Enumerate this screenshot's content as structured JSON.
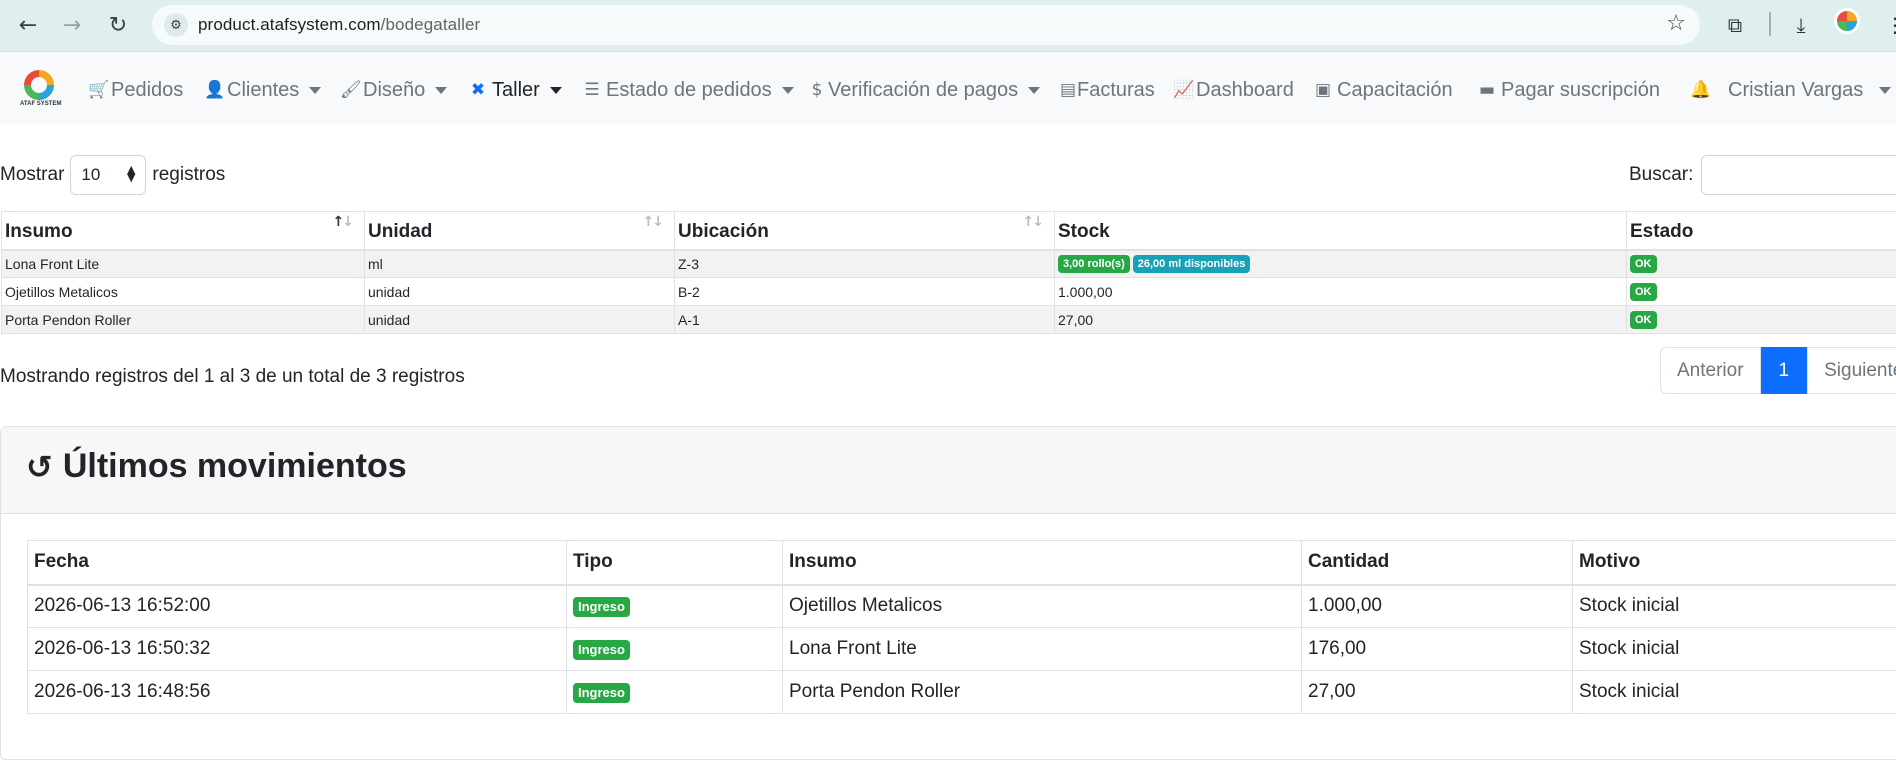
{
  "browser": {
    "url_host": "product.atafsystem.com",
    "url_path": "/bodegataller"
  },
  "navbar": {
    "logo_text": "ATAF SYSTEM",
    "items": [
      {
        "label": "Pedidos",
        "icon": "cart-icon",
        "dropdown": false
      },
      {
        "label": "Clientes",
        "icon": "users-icon",
        "dropdown": true
      },
      {
        "label": "Diseño",
        "icon": "brush-icon",
        "dropdown": true
      },
      {
        "label": "Taller",
        "icon": "tools-icon",
        "dropdown": true,
        "active": true
      },
      {
        "label": "Estado de pedidos",
        "icon": "list-check-icon",
        "dropdown": true
      },
      {
        "label": "Verificación de pagos",
        "icon": "dollar-icon",
        "dropdown": true
      },
      {
        "label": "Facturas",
        "icon": "invoice-icon",
        "dropdown": false
      },
      {
        "label": "Dashboard",
        "icon": "chart-line-icon",
        "dropdown": false
      },
      {
        "label": "Capacitación",
        "icon": "chalkboard-icon",
        "dropdown": false
      },
      {
        "label": "Pagar suscripción",
        "icon": "credit-card-icon",
        "dropdown": false
      }
    ],
    "user_name": "Cristian Vargas"
  },
  "datatable": {
    "length_prefix": "Mostrar",
    "length_value": "10",
    "length_suffix": "registros",
    "search_label": "Buscar:",
    "columns": [
      "Insumo",
      "Unidad",
      "Ubicación",
      "Stock",
      "Estado"
    ],
    "rows": [
      {
        "insumo": "Lona Front Lite",
        "unidad": "ml",
        "ubicacion": "Z-3",
        "stock_badges": [
          "3,00 rollo(s)",
          "26,00 ml disponibles"
        ],
        "estado": "OK"
      },
      {
        "insumo": "Ojetillos Metalicos",
        "unidad": "unidad",
        "ubicacion": "B-2",
        "stock": "1.000,00",
        "estado": "OK"
      },
      {
        "insumo": "Porta Pendon Roller",
        "unidad": "unidad",
        "ubicacion": "A-1",
        "stock": "27,00",
        "estado": "OK"
      }
    ],
    "info": "Mostrando registros del 1 al 3 de un total de 3 registros",
    "pager": {
      "prev": "Anterior",
      "current": "1",
      "next": "Siguiente"
    }
  },
  "movimientos": {
    "title": "Últimos movimientos",
    "columns": [
      "Fecha",
      "Tipo",
      "Insumo",
      "Cantidad",
      "Motivo"
    ],
    "rows": [
      {
        "fecha": "2026-06-13 16:52:00",
        "tipo": "Ingreso",
        "insumo": "Ojetillos Metalicos",
        "cantidad": "1.000,00",
        "motivo": "Stock inicial"
      },
      {
        "fecha": "2026-06-13 16:50:32",
        "tipo": "Ingreso",
        "insumo": "Lona Front Lite",
        "cantidad": "176,00",
        "motivo": "Stock inicial"
      },
      {
        "fecha": "2026-06-13 16:48:56",
        "tipo": "Ingreso",
        "insumo": "Porta Pendon Roller",
        "cantidad": "27,00",
        "motivo": "Stock inicial"
      }
    ]
  },
  "colors": {
    "success": "#28a745",
    "info": "#17a2b8",
    "primary": "#0d6efd"
  }
}
